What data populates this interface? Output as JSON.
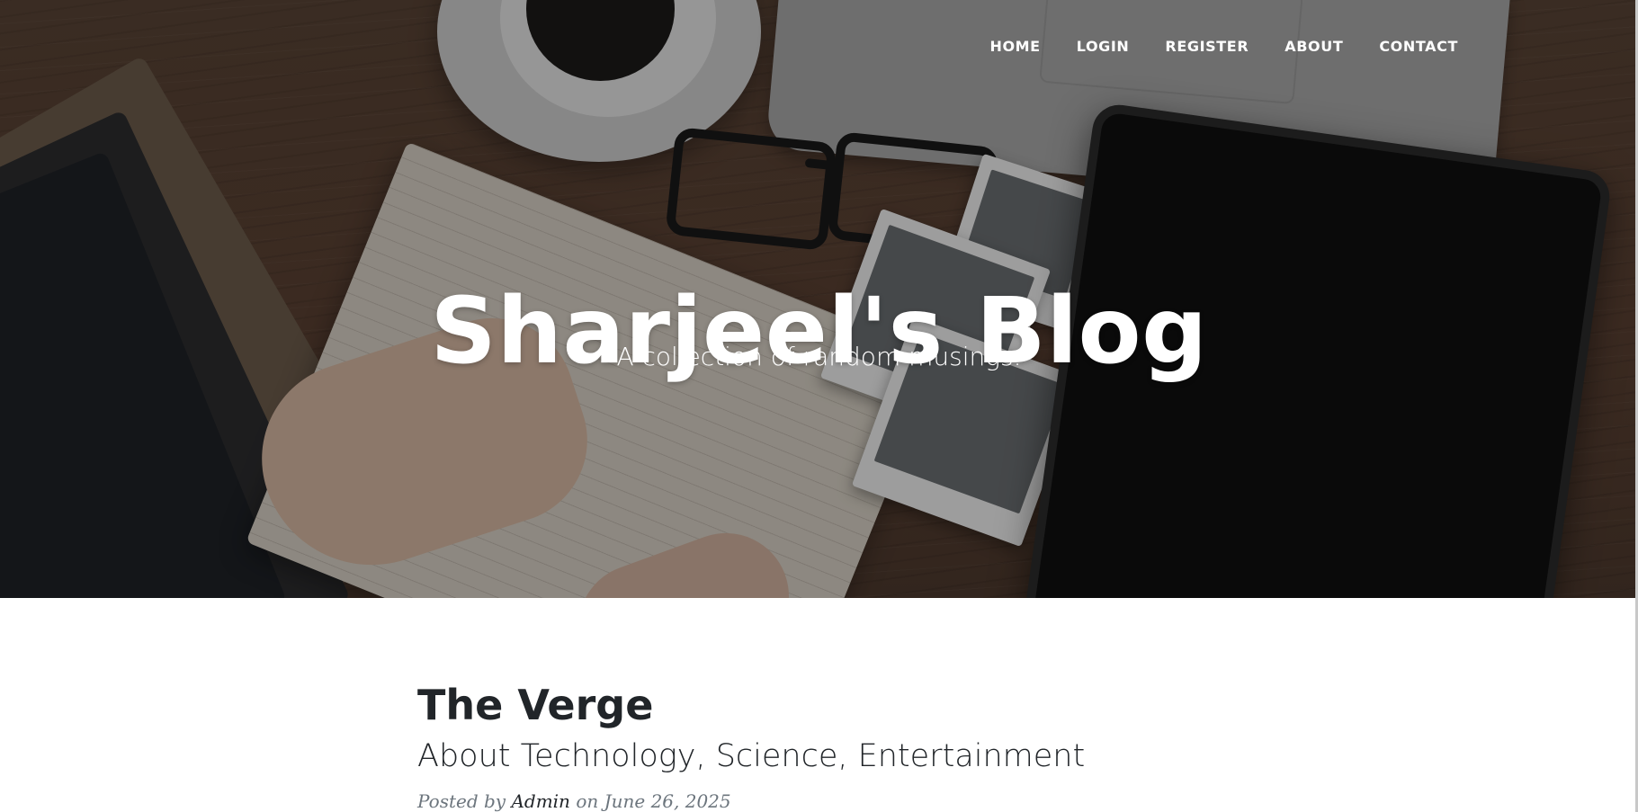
{
  "nav": {
    "items": [
      {
        "label": "HOME"
      },
      {
        "label": "LOGIN"
      },
      {
        "label": "REGISTER"
      },
      {
        "label": "ABOUT"
      },
      {
        "label": "CONTACT"
      }
    ]
  },
  "hero": {
    "title": "Sharjeel's Blog",
    "subtitle": "A collection of random musings."
  },
  "posts": [
    {
      "title": "The Verge",
      "subtitle": "About Technology, Science, Entertainment",
      "meta_prefix": "Posted by",
      "author": "Admin",
      "meta_suffix": "on June 26, 2025"
    }
  ],
  "colors": {
    "hero_overlay": "#000000",
    "heading_text": "#212529",
    "meta_text": "#6c757d",
    "nav_text": "#ffffff"
  },
  "icons": []
}
